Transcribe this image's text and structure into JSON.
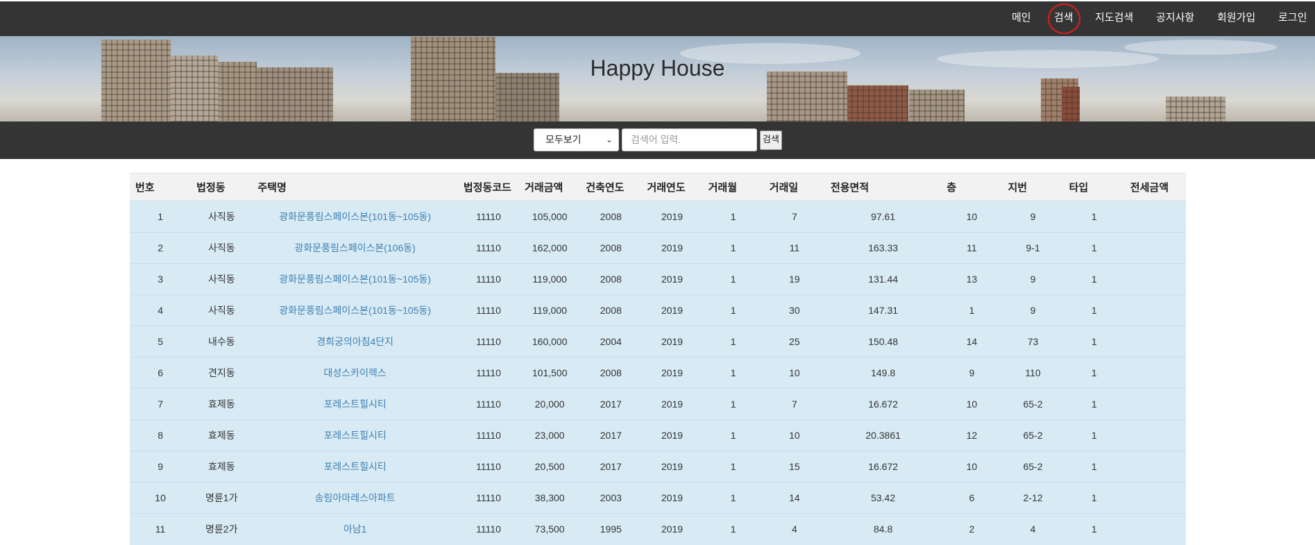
{
  "nav": {
    "items": [
      "메인",
      "검색",
      "지도검색",
      "공지사항",
      "회원가입",
      "로그인"
    ],
    "active_index": 1
  },
  "banner": {
    "title": "Happy House"
  },
  "search": {
    "select_value": "모두보기",
    "placeholder": "검색어 입력.",
    "button_label": "검색"
  },
  "table": {
    "headers": [
      "번호",
      "법정동",
      "주택명",
      "법정동코드",
      "거래금액",
      "건축연도",
      "거래연도",
      "거래월",
      "거래일",
      "전용면적",
      "층",
      "지번",
      "타입",
      "전세금액"
    ],
    "rows": [
      [
        "1",
        "사직동",
        "광화문풍림스페이스본(101동~105동)",
        "11110",
        "105,000",
        "2008",
        "2019",
        "1",
        "7",
        "97.61",
        "10",
        "9",
        "1",
        ""
      ],
      [
        "2",
        "사직동",
        "광화문풍림스페이스본(106동)",
        "11110",
        "162,000",
        "2008",
        "2019",
        "1",
        "11",
        "163.33",
        "11",
        "9-1",
        "1",
        ""
      ],
      [
        "3",
        "사직동",
        "광화문풍림스페이스본(101동~105동)",
        "11110",
        "119,000",
        "2008",
        "2019",
        "1",
        "19",
        "131.44",
        "13",
        "9",
        "1",
        ""
      ],
      [
        "4",
        "사직동",
        "광화문풍림스페이스본(101동~105동)",
        "11110",
        "119,000",
        "2008",
        "2019",
        "1",
        "30",
        "147.31",
        "1",
        "9",
        "1",
        ""
      ],
      [
        "5",
        "내수동",
        "경희궁의아침4단지",
        "11110",
        "160,000",
        "2004",
        "2019",
        "1",
        "25",
        "150.48",
        "14",
        "73",
        "1",
        ""
      ],
      [
        "6",
        "견지동",
        "대성스카이렉스",
        "11110",
        "101,500",
        "2008",
        "2019",
        "1",
        "10",
        "149.8",
        "9",
        "110",
        "1",
        ""
      ],
      [
        "7",
        "효제동",
        "포레스트힐시티",
        "11110",
        "20,000",
        "2017",
        "2019",
        "1",
        "7",
        "16.672",
        "10",
        "65-2",
        "1",
        ""
      ],
      [
        "8",
        "효제동",
        "포레스트힐시티",
        "11110",
        "23,000",
        "2017",
        "2019",
        "1",
        "10",
        "20.3861",
        "12",
        "65-2",
        "1",
        ""
      ],
      [
        "9",
        "효제동",
        "포레스트힐시티",
        "11110",
        "20,500",
        "2017",
        "2019",
        "1",
        "15",
        "16.672",
        "10",
        "65-2",
        "1",
        ""
      ],
      [
        "10",
        "명륜1가",
        "송림아마레스아파트",
        "11110",
        "38,300",
        "2003",
        "2019",
        "1",
        "14",
        "53.42",
        "6",
        "2-12",
        "1",
        ""
      ],
      [
        "11",
        "명륜2가",
        "아남1",
        "11110",
        "73,500",
        "1995",
        "2019",
        "1",
        "4",
        "84.8",
        "2",
        "4",
        "1",
        ""
      ]
    ]
  },
  "colors": {
    "nav_bg": "#343434",
    "row_bg": "#d8ebf5",
    "link": "#3e7fb1",
    "highlight": "#e11b1b"
  }
}
